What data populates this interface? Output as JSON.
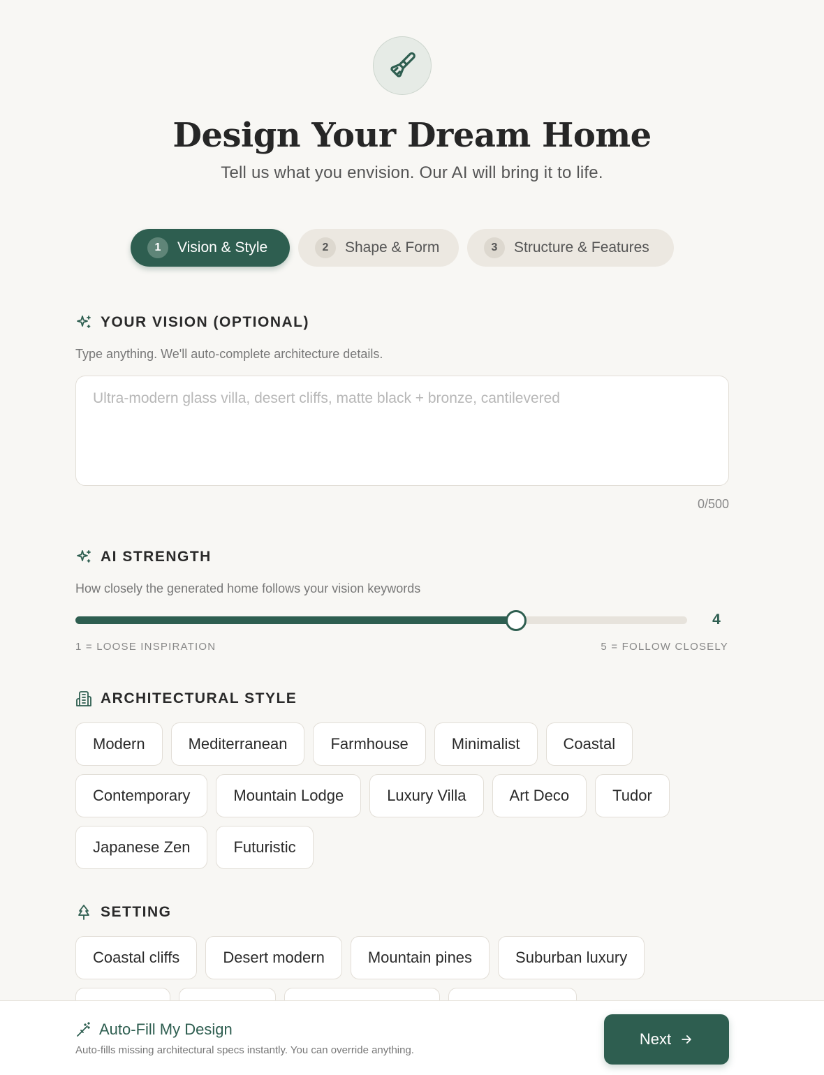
{
  "header": {
    "title": "Design Your Dream Home",
    "subtitle": "Tell us what you envision. Our AI will bring it to life.",
    "icon": "paintbrush-icon"
  },
  "steps": [
    {
      "num": "1",
      "label": "Vision & Style",
      "active": true
    },
    {
      "num": "2",
      "label": "Shape & Form",
      "active": false
    },
    {
      "num": "3",
      "label": "Structure & Features",
      "active": false
    }
  ],
  "vision": {
    "heading": "YOUR VISION (OPTIONAL)",
    "hint": "Type anything. We'll auto-complete architecture details.",
    "placeholder": "Ultra-modern glass villa, desert cliffs, matte black + bronze, cantilevered",
    "value": "",
    "counter": "0/500"
  },
  "ai_strength": {
    "heading": "AI STRENGTH",
    "hint": "How closely the generated home follows your vision keywords",
    "value": "4",
    "min": 1,
    "max": 5,
    "min_label": "1 = LOOSE INSPIRATION",
    "max_label": "5 = FOLLOW CLOSELY"
  },
  "architectural_style": {
    "heading": "ARCHITECTURAL STYLE",
    "options": [
      "Modern",
      "Mediterranean",
      "Farmhouse",
      "Minimalist",
      "Coastal",
      "Contemporary",
      "Mountain Lodge",
      "Luxury Villa",
      "Art Deco",
      "Tudor",
      "Japanese Zen",
      "Futuristic"
    ]
  },
  "setting": {
    "heading": "SETTING",
    "options": [
      "Coastal cliffs",
      "Desert modern",
      "Mountain pines",
      "Suburban luxury"
    ]
  },
  "footer": {
    "autofill_label": "Auto-Fill My Design",
    "autofill_desc": "Auto-fills missing architectural specs instantly. You can override anything.",
    "next_label": "Next"
  },
  "colors": {
    "accent": "#2e5e50",
    "background": "#f8f7f4"
  }
}
